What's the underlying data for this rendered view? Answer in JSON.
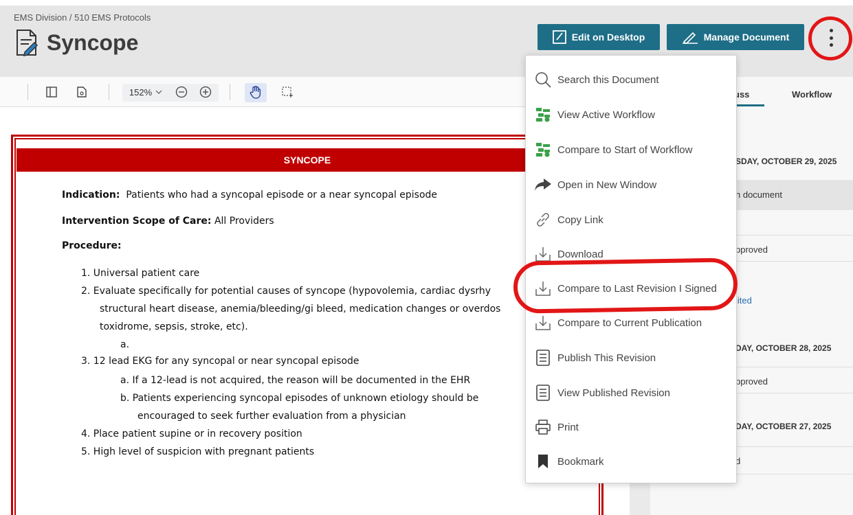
{
  "header": {
    "breadcrumb": "EMS Division / 510 EMS Protocols",
    "title": "Syncope",
    "edit_button": "Edit on Desktop",
    "manage_button": "Manage Document"
  },
  "toolbar": {
    "zoom": "152%"
  },
  "right_panel": {
    "tab_discuss": "uss",
    "tab_workflow": "Workflow",
    "date1": "SDAY, OCTOBER 29, 2025",
    "entry1": "n document",
    "entry2": "pproved",
    "entry3": "lited",
    "date2": "DAY, OCTOBER 28, 2025",
    "entry4": "pproved",
    "date3": "DAY, OCTOBER 27, 2025",
    "entry5": "d"
  },
  "document": {
    "band_title": "SYNCOPE",
    "indication_label": "Indication:",
    "indication_text": "Patients who had a syncopal episode or a near syncopal episode",
    "scope_label": "Intervention Scope of Care:",
    "scope_text": "All Providers",
    "procedure_label": "Procedure:",
    "lines": [
      "1.  Universal patient care",
      "2.  Evaluate specifically for potential causes of syncope (hypovolemia, cardiac dysrhy",
      "structural heart disease, anemia/bleeding/gi bleed, medication changes or overdos",
      "toxidrome, sepsis, stroke, etc).",
      "a.",
      "3.  12 lead EKG for any syncopal or near syncopal episode",
      "a.  If a 12-lead is not acquired, the reason will be documented in the EHR",
      "b.  Patients experiencing syncopal episodes of unknown etiology should be",
      "encouraged to seek further evaluation from a physician",
      "4.  Place patient supine or in recovery position",
      "5.  High level of suspicion with pregnant patients"
    ]
  },
  "menu": {
    "items": [
      {
        "label": "Search this Document",
        "icon": "search-icon"
      },
      {
        "label": "View Active Workflow",
        "icon": "workflow-icon"
      },
      {
        "label": "Compare to Start of Workflow",
        "icon": "workflow-icon"
      },
      {
        "label": "Open in New Window",
        "icon": "share-arrow-icon"
      },
      {
        "label": "Copy Link",
        "icon": "link-icon"
      },
      {
        "label": "Download",
        "icon": "download-icon"
      },
      {
        "label": "Compare to Last Revision I Signed",
        "icon": "download-icon"
      },
      {
        "label": "Compare to Current Publication",
        "icon": "download-icon"
      },
      {
        "label": "Publish This Revision",
        "icon": "document-icon"
      },
      {
        "label": "View Published Revision",
        "icon": "document-icon"
      },
      {
        "label": "Print",
        "icon": "print-icon"
      },
      {
        "label": "Bookmark",
        "icon": "bookmark-icon"
      }
    ]
  },
  "colors": {
    "accent": "#1e6e87",
    "doc_red": "#c00000",
    "annotation_red": "#e21616",
    "workflow_green": "#3aa14a"
  }
}
